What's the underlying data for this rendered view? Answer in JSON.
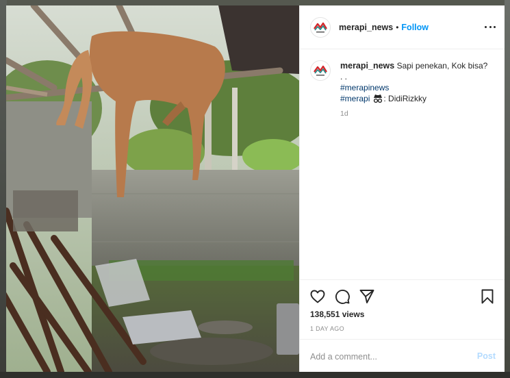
{
  "post": {
    "username": "merapi_news",
    "separator": "•",
    "follow_label": "Follow",
    "caption_text": "Sapi penekan, Kok bisa?",
    "caption_dots": ". .",
    "hashtag_1": "#merapinews",
    "hashtag_2": "#merapi",
    "credit_icon": "incognito-icon",
    "credit_text": ": DidiRizkky",
    "relative_time": "1d",
    "views": "138,551 views",
    "time_ago": "1 DAY AGO"
  },
  "comment": {
    "placeholder": "Add a comment...",
    "post_label": "Post"
  },
  "colors": {
    "accent": "#0095f6",
    "post_disabled": "#b3dbff",
    "hashtag": "#00376b",
    "logo_red": "#d3272c",
    "logo_teal": "#2a8c8a"
  },
  "icons": [
    "heart-icon",
    "comment-icon",
    "share-icon",
    "bookmark-icon",
    "more-options-icon"
  ]
}
